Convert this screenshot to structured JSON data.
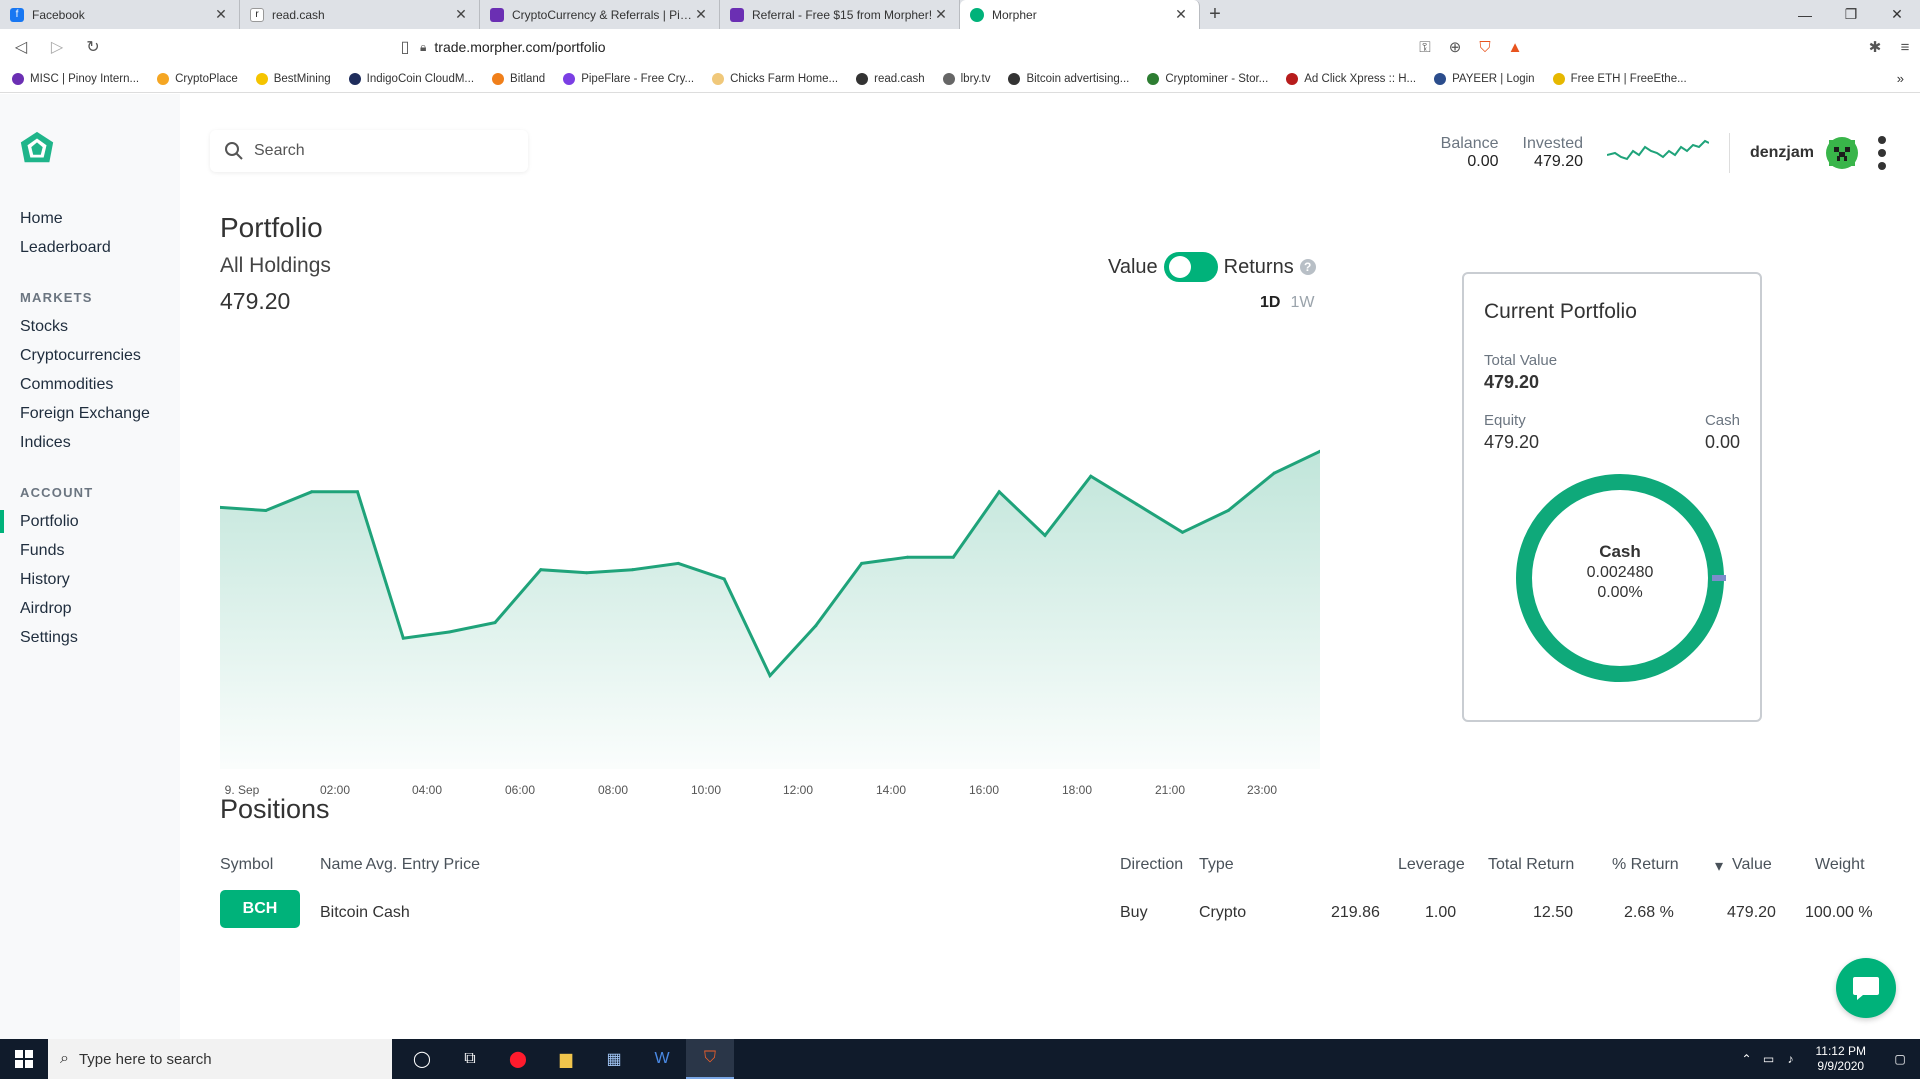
{
  "browser": {
    "tabs": [
      {
        "title": "Facebook",
        "fav": "f",
        "color": "#1877f2"
      },
      {
        "title": "read.cash",
        "fav": "r",
        "color": "#ffffff"
      },
      {
        "title": "CryptoCurrency & Referrals | Pinoy",
        "fav": "",
        "color": "#6b2fb3"
      },
      {
        "title": "Referral - Free $15 from Morpher!",
        "fav": "",
        "color": "#6b2fb3"
      },
      {
        "title": "Morpher",
        "fav": "",
        "color": "#00b27a"
      }
    ],
    "url": "trade.morpher.com/portfolio",
    "bookmarks": [
      {
        "label": "MISC | Pinoy Intern...",
        "color": "#6b2fb3"
      },
      {
        "label": "CryptoPlace",
        "color": "#f5a623"
      },
      {
        "label": "BestMining",
        "color": "#f5c400"
      },
      {
        "label": "IndigoCoin CloudM...",
        "color": "#1f2d5c"
      },
      {
        "label": "Bitland",
        "color": "#f07f1a"
      },
      {
        "label": "PipeFlare - Free Cry...",
        "color": "#7b3fe4"
      },
      {
        "label": "Chicks Farm Home...",
        "color": "#f0c87a"
      },
      {
        "label": "read.cash",
        "color": "#333333"
      },
      {
        "label": "lbry.tv",
        "color": "#666666"
      },
      {
        "label": "Bitcoin advertising...",
        "color": "#333333"
      },
      {
        "label": "Cryptominer - Stor...",
        "color": "#2d7d32"
      },
      {
        "label": "Ad Click Xpress :: H...",
        "color": "#b71c1c"
      },
      {
        "label": "PAYEER | Login",
        "color": "#2b4d8c"
      },
      {
        "label": "Free ETH | FreeEthe...",
        "color": "#e6b800"
      }
    ]
  },
  "sidebar": {
    "items_top": [
      "Home",
      "Leaderboard"
    ],
    "markets_heading": "MARKETS",
    "markets": [
      "Stocks",
      "Cryptocurrencies",
      "Commodities",
      "Foreign Exchange",
      "Indices"
    ],
    "account_heading": "ACCOUNT",
    "account": [
      "Portfolio",
      "Funds",
      "History",
      "Airdrop",
      "Settings"
    ],
    "active": "Portfolio"
  },
  "header": {
    "search_placeholder": "Search",
    "balance_label": "Balance",
    "balance_value": "0.00",
    "invested_label": "Invested",
    "invested_value": "479.20",
    "username": "denzjam"
  },
  "portfolio": {
    "title": "Portfolio",
    "subtitle": "All Holdings",
    "value": "479.20",
    "toggle_left": "Value",
    "toggle_right": "Returns",
    "range_1d": "1D",
    "range_1w": "1W"
  },
  "chart_data": {
    "type": "area",
    "xlabel": "",
    "ylabel": "",
    "x_ticks": [
      "9. Sep",
      "02:00",
      "04:00",
      "06:00",
      "08:00",
      "10:00",
      "12:00",
      "14:00",
      "16:00",
      "18:00",
      "21:00",
      "23:00"
    ],
    "values": [
      479.04,
      479.03,
      479.09,
      479.09,
      478.62,
      478.64,
      478.67,
      478.84,
      478.83,
      478.84,
      478.86,
      478.81,
      478.5,
      478.66,
      478.86,
      478.88,
      478.88,
      479.09,
      478.95,
      479.14,
      479.05,
      478.96,
      479.03,
      479.15,
      479.22
    ],
    "ylim": [
      478.2,
      479.42
    ],
    "grid": false,
    "color": "#1fa37a"
  },
  "current_portfolio": {
    "title": "Current Portfolio",
    "total_value_label": "Total Value",
    "total_value": "479.20",
    "equity_label": "Equity",
    "equity_value": "479.20",
    "cash_label": "Cash",
    "cash_value": "0.00",
    "donut_title": "Cash",
    "donut_amount": "0.002480",
    "donut_percent": "0.00%",
    "equity_color": "#0fa97a",
    "cash_color": "#7d8ccc"
  },
  "positions": {
    "title": "Positions",
    "columns": [
      "Symbol",
      "Name",
      "Direction",
      "Type",
      "Avg. Entry Price",
      "Leverage",
      "Total Return",
      "% Return",
      "Value",
      "Weight"
    ],
    "rows": [
      {
        "symbol": "BCH",
        "name": "Bitcoin Cash",
        "direction": "Buy",
        "type": "Crypto",
        "entry": "219.86",
        "leverage": "1.00",
        "total_return": "12.50",
        "pct_return": "2.68 %",
        "value": "479.20",
        "weight": "100.00 %"
      }
    ]
  },
  "taskbar": {
    "search_placeholder": "Type here to search",
    "time": "11:12 PM",
    "date": "9/9/2020"
  }
}
